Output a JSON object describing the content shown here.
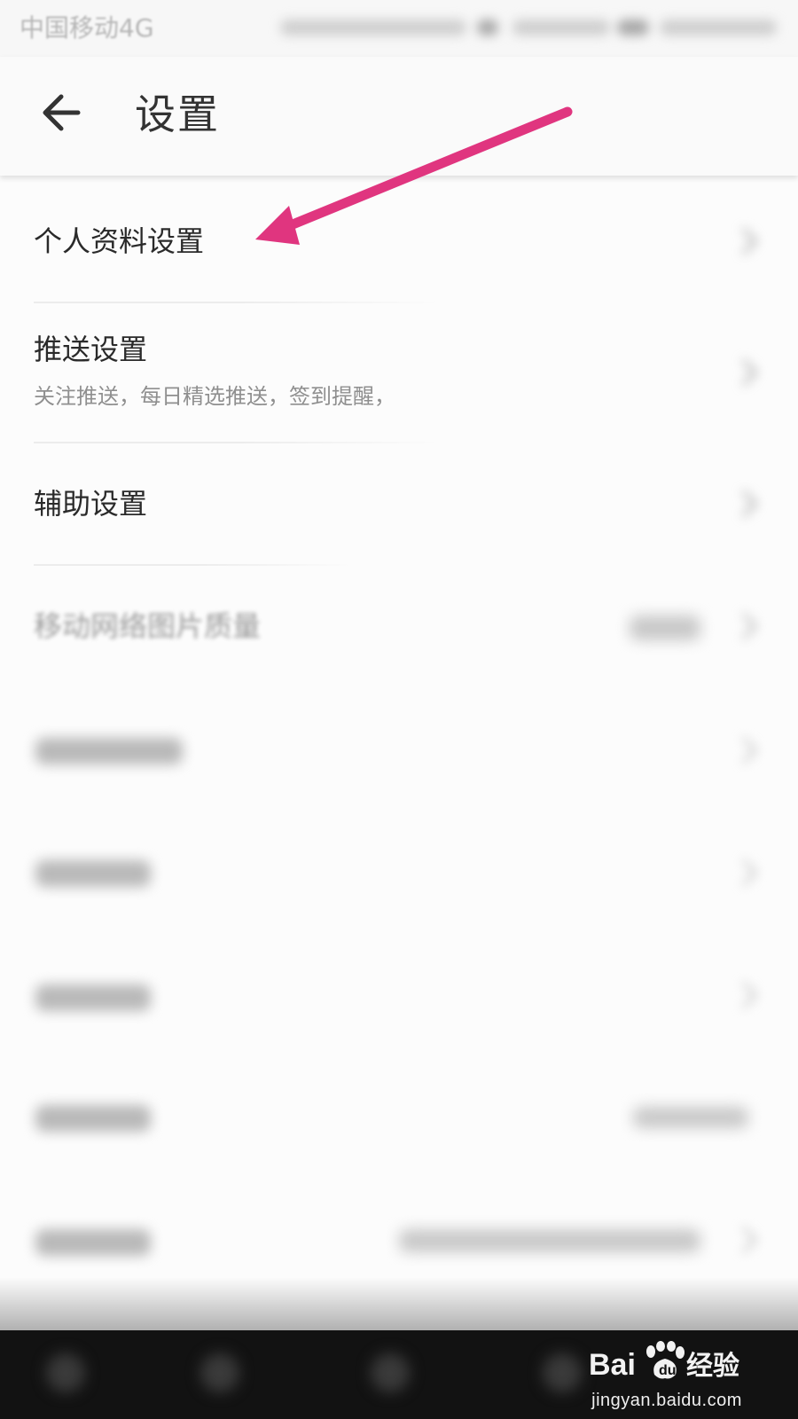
{
  "status_bar": {
    "carrier": "中国移动4G"
  },
  "app_bar": {
    "back_icon": "arrow-left-icon",
    "title": "设置"
  },
  "settings": {
    "items": [
      {
        "label": "个人资料设置",
        "subtitle": ""
      },
      {
        "label": "推送设置",
        "subtitle": "关注推送，每日精选推送，签到提醒，",
        "subtitle_blurred": ""
      },
      {
        "label": "辅助设置",
        "subtitle": ""
      },
      {
        "label": "移动网络图片质量",
        "subtitle": ""
      }
    ],
    "chevron_icon": "chevron-right-icon"
  },
  "annotation": {
    "arrow_color": "#e0357f"
  },
  "watermark": {
    "logo_text": "Bai经验",
    "url": "jingyan.baidu.com"
  }
}
